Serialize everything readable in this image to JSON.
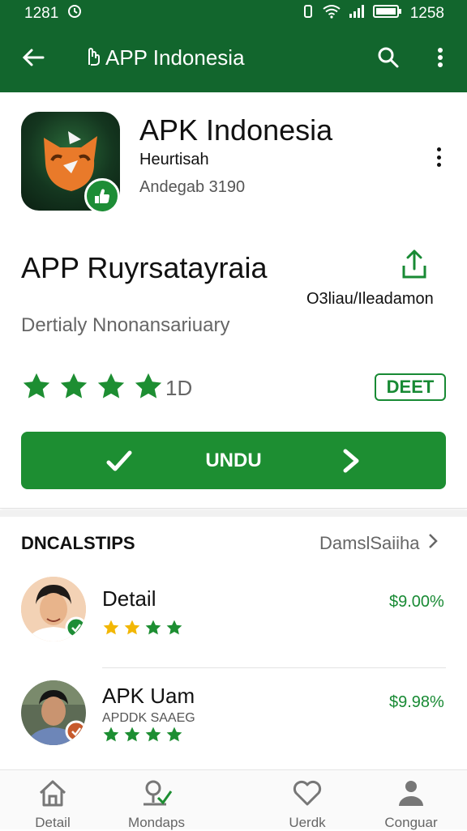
{
  "status_bar": {
    "time": "1281",
    "battery_text": "1258"
  },
  "app_bar": {
    "title": "APP Indonesia"
  },
  "app": {
    "name": "APK Indonesia",
    "developer": "Heurtisah",
    "subinfo": "Andegab 3190",
    "headline": "APP Ruyrsatayraia",
    "share_label": "O3liau/Ileadamon",
    "tagline": "Dertialy Nnonansariuary",
    "rating": 4,
    "rating_count": "1D",
    "detail_badge": "DEET",
    "install_label": "UNDU"
  },
  "section": {
    "title": "DNCALSTIPS",
    "link": "DamslSaiiha"
  },
  "list": [
    {
      "title": "Detail",
      "subtitle": "",
      "price": "$9.00%",
      "stars": 4
    },
    {
      "title": "APK Uam",
      "subtitle": "APDDK SAAEG",
      "price": "$9.98%",
      "stars": 4
    }
  ],
  "bottom_nav": [
    {
      "label": "Detail",
      "icon": "house-icon"
    },
    {
      "label": "Mondaps",
      "icon": "map-pin-icon"
    },
    {
      "label": "Uerdk",
      "icon": "heart-icon"
    },
    {
      "label": "Conguar",
      "icon": "person-icon"
    }
  ],
  "colors": {
    "primary": "#12662d",
    "accent": "#1d8e32",
    "star_yellow": "#f2b705"
  }
}
